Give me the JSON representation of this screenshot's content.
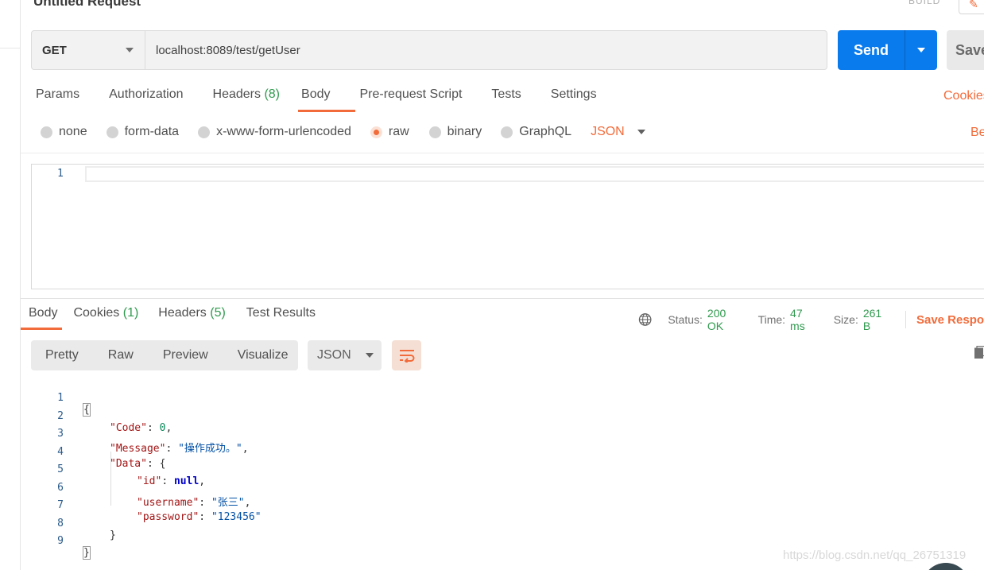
{
  "request": {
    "title": "Untitled Request",
    "build_label": "BUILD",
    "method": "GET",
    "url": "localhost:8089/test/getUser",
    "send_label": "Send",
    "save_label": "Save"
  },
  "request_tabs": [
    {
      "label": "Params",
      "count": ""
    },
    {
      "label": "Authorization",
      "count": ""
    },
    {
      "label": "Headers",
      "count": "(8)"
    },
    {
      "label": "Body",
      "count": "",
      "active": true
    },
    {
      "label": "Pre-request Script",
      "count": ""
    },
    {
      "label": "Tests",
      "count": ""
    },
    {
      "label": "Settings",
      "count": ""
    }
  ],
  "cookies_link": "Cookies",
  "body_types": {
    "none": "none",
    "form_data": "form-data",
    "urlencoded": "x-www-form-urlencoded",
    "raw": "raw",
    "binary": "binary",
    "graphql": "GraphQL",
    "selected": "raw",
    "format": "JSON"
  },
  "beautify_link": "Be",
  "editor": {
    "line_numbers": [
      "1"
    ]
  },
  "response_tabs": [
    {
      "label": "Body",
      "count": "",
      "active": true
    },
    {
      "label": "Cookies",
      "count": "(1)"
    },
    {
      "label": "Headers",
      "count": "(5)"
    },
    {
      "label": "Test Results",
      "count": ""
    }
  ],
  "response_meta": {
    "status_label": "Status:",
    "status_value": "200 OK",
    "time_label": "Time:",
    "time_value": "47 ms",
    "size_label": "Size:",
    "size_value": "261 B",
    "save_response": "Save Respo"
  },
  "view_modes": [
    "Pretty",
    "Raw",
    "Preview",
    "Visualize"
  ],
  "view_format": "JSON",
  "response_body": {
    "line_numbers": [
      "1",
      "2",
      "3",
      "4",
      "5",
      "6",
      "7",
      "8",
      "9"
    ],
    "code_key": "\"Code\"",
    "code_value": "0",
    "message_key": "\"Message\"",
    "message_value": "\"操作成功。\"",
    "data_key": "\"Data\"",
    "id_key": "\"id\"",
    "id_value": "null",
    "username_key": "\"username\"",
    "username_value": "\"张三\"",
    "password_key": "\"password\"",
    "password_value": "\"123456\""
  },
  "watermark": "https://blog.csdn.net/qq_26751319",
  "colors": {
    "accent": "#f26b3a",
    "send": "#097bed",
    "count_green": "#2f9a4e"
  }
}
